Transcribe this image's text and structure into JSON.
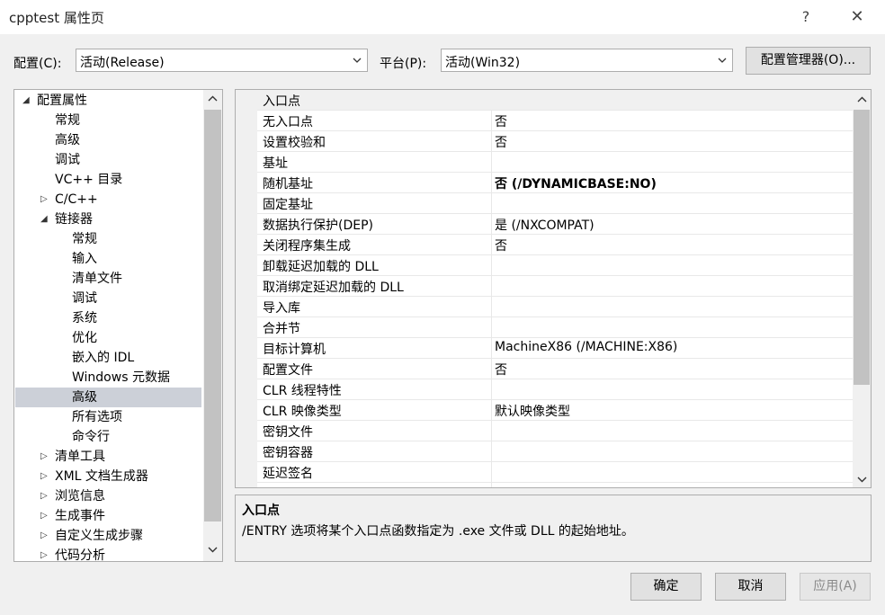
{
  "window": {
    "title": "cpptest 属性页",
    "help": "?",
    "close": "✕"
  },
  "config_bar": {
    "config_label": "配置(C):",
    "config_value": "活动(Release)",
    "platform_label": "平台(P):",
    "platform_value": "活动(Win32)",
    "manager_button": "配置管理器(O)..."
  },
  "tree": {
    "items": [
      {
        "label": "配置属性",
        "twisty": "◢"
      },
      {
        "label": "常规"
      },
      {
        "label": "高级"
      },
      {
        "label": "调试"
      },
      {
        "label": "VC++ 目录"
      },
      {
        "label": "C/C++",
        "twisty": "▷"
      },
      {
        "label": "链接器",
        "twisty": "◢"
      },
      {
        "label": "常规"
      },
      {
        "label": "输入"
      },
      {
        "label": "清单文件"
      },
      {
        "label": "调试"
      },
      {
        "label": "系统"
      },
      {
        "label": "优化"
      },
      {
        "label": "嵌入的 IDL"
      },
      {
        "label": "Windows 元数据"
      },
      {
        "label": "高级",
        "selected": true
      },
      {
        "label": "所有选项"
      },
      {
        "label": "命令行"
      },
      {
        "label": "清单工具",
        "twisty": "▷"
      },
      {
        "label": "XML 文档生成器",
        "twisty": "▷"
      },
      {
        "label": "浏览信息",
        "twisty": "▷"
      },
      {
        "label": "生成事件",
        "twisty": "▷"
      },
      {
        "label": "自定义生成步骤",
        "twisty": "▷"
      },
      {
        "label": "代码分析",
        "twisty": "▷"
      }
    ]
  },
  "grid": {
    "rows": [
      {
        "name": "入口点",
        "value": ""
      },
      {
        "name": "无入口点",
        "value": "否"
      },
      {
        "name": "设置校验和",
        "value": "否"
      },
      {
        "name": "基址",
        "value": ""
      },
      {
        "name": "随机基址",
        "value": "否 (/DYNAMICBASE:NO)",
        "bold": true
      },
      {
        "name": "固定基址",
        "value": ""
      },
      {
        "name": "数据执行保护(DEP)",
        "value": "是 (/NXCOMPAT)"
      },
      {
        "name": "关闭程序集生成",
        "value": "否"
      },
      {
        "name": "卸载延迟加载的 DLL",
        "value": ""
      },
      {
        "name": "取消绑定延迟加载的 DLL",
        "value": ""
      },
      {
        "name": "导入库",
        "value": ""
      },
      {
        "name": "合并节",
        "value": ""
      },
      {
        "name": "目标计算机",
        "value": "MachineX86 (/MACHINE:X86)"
      },
      {
        "name": "配置文件",
        "value": "否"
      },
      {
        "name": "CLR 线程特性",
        "value": ""
      },
      {
        "name": "CLR 映像类型",
        "value": "默认映像类型"
      },
      {
        "name": "密钥文件",
        "value": ""
      },
      {
        "name": "密钥容器",
        "value": ""
      },
      {
        "name": "延迟签名",
        "value": ""
      }
    ]
  },
  "description": {
    "title": "入口点",
    "text": "/ENTRY 选项将某个入口点函数指定为 .exe 文件或 DLL 的起始地址。"
  },
  "buttons": {
    "ok": "确定",
    "cancel": "取消",
    "apply": "应用(A)"
  }
}
